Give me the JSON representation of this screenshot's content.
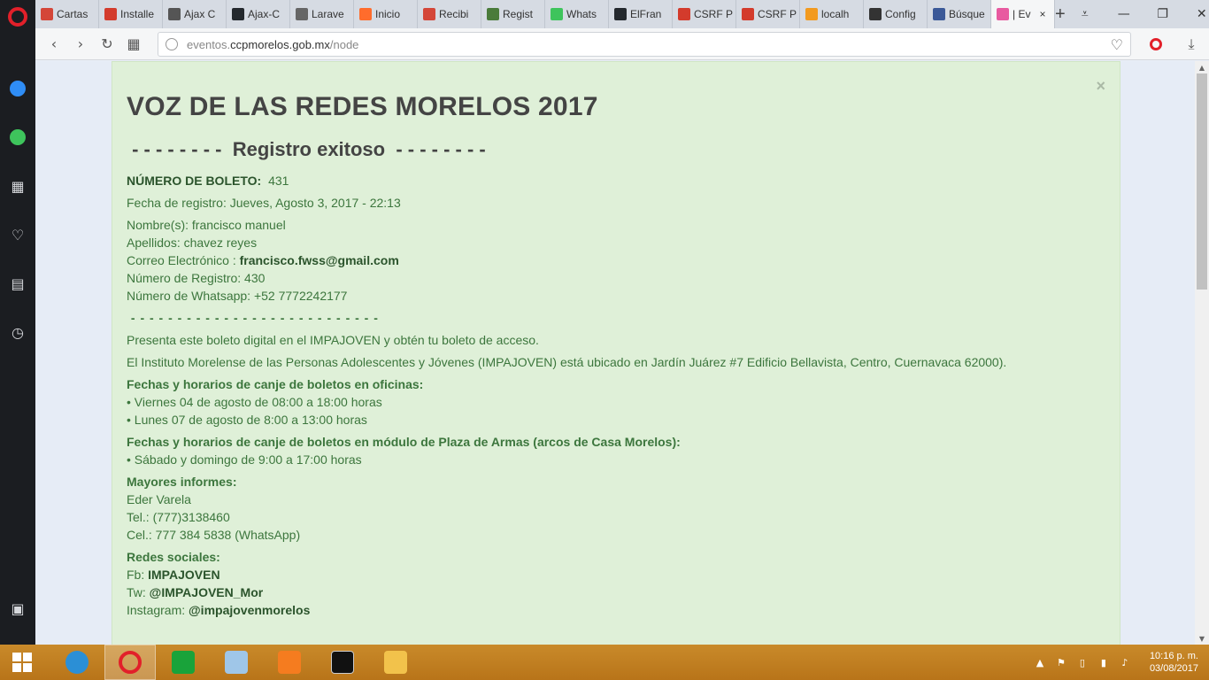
{
  "browser": {
    "tabs": [
      {
        "label": "Cartas",
        "color": "#d44638"
      },
      {
        "label": "Installe",
        "color": "#d33b2c"
      },
      {
        "label": "Ajax C",
        "color": "#555555"
      },
      {
        "label": "Ajax-C",
        "color": "#24292e"
      },
      {
        "label": "Larave",
        "color": "#666666"
      },
      {
        "label": "Inicio",
        "color": "#ff6c2c"
      },
      {
        "label": "Recibi",
        "color": "#d44638"
      },
      {
        "label": "Regist",
        "color": "#4a7b3a"
      },
      {
        "label": "Whats",
        "color": "#3ec45c"
      },
      {
        "label": "ElFran",
        "color": "#24292e"
      },
      {
        "label": "CSRF P",
        "color": "#d33b2c"
      },
      {
        "label": "CSRF P",
        "color": "#d33b2c"
      },
      {
        "label": "localh",
        "color": "#f29a1f"
      },
      {
        "label": "Config",
        "color": "#333333"
      },
      {
        "label": "Búsque",
        "color": "#3b5998"
      },
      {
        "label": "| Ev",
        "color": "#e85aa0"
      }
    ],
    "url_prefix": "eventos.",
    "url_domain": "ccpmorelos.gob.mx",
    "url_path": "/node"
  },
  "page": {
    "title": "VOZ DE LAS REDES MORELOS 2017",
    "subtitle": " - - - - - - - -  Registro exitoso  - - - - - - - -",
    "ticket_label": "NÚMERO DE BOLETO:",
    "ticket_number": "431",
    "registration_date": "Fecha de registro: Jueves, Agosto 3, 2017 - 22:13",
    "names": "Nombre(s): francisco manuel",
    "surnames": "Apellidos: chavez reyes",
    "email_label": "Correo Electrónico : ",
    "email_value": "francisco.fwss@gmail.com",
    "registration_number": "Número de Registro: 430",
    "whatsapp": "Número de Whatsapp: +52 7772242177",
    "separator": " - - - - - - - - - - - - - - - - - - - - - - - - - - -",
    "present_text": "Presenta este boleto digital en el IMPAJOVEN y obtén tu boleto de acceso.",
    "location_text": "El Instituto Morelense de las Personas Adolescentes y Jóvenes (IMPAJOVEN) está ubicado en Jardín Juárez #7 Edificio Bellavista, Centro, Cuernavaca 62000).",
    "offices_heading": "Fechas y horarios de canje de boletos en oficinas:",
    "offices_items": [
      "• Viernes 04 de agosto de 08:00 a 18:00 horas",
      "• Lunes 07 de agosto de 8:00 a 13:00 horas"
    ],
    "module_heading": "Fechas y horarios de canje de boletos en módulo de Plaza de Armas (arcos de Casa Morelos):",
    "module_items": [
      "• Sábado y domingo de 9:00 a 17:00 horas"
    ],
    "info_heading": "Mayores informes:",
    "info_name": "Eder Varela",
    "info_tel": "Tel.: (777)3138460",
    "info_cel": "Cel.: 777 384 5838 (WhatsApp)",
    "social_heading": "Redes sociales:",
    "fb_label": "Fb: ",
    "fb_value": "IMPAJOVEN",
    "tw_label": "Tw: ",
    "tw_value": "@IMPAJOVEN_Mor",
    "ig_label": "Instagram: ",
    "ig_value": "@impajovenmorelos",
    "close": "×"
  },
  "taskbar": {
    "time": "10:16 p. m.",
    "date": "03/08/2017"
  }
}
